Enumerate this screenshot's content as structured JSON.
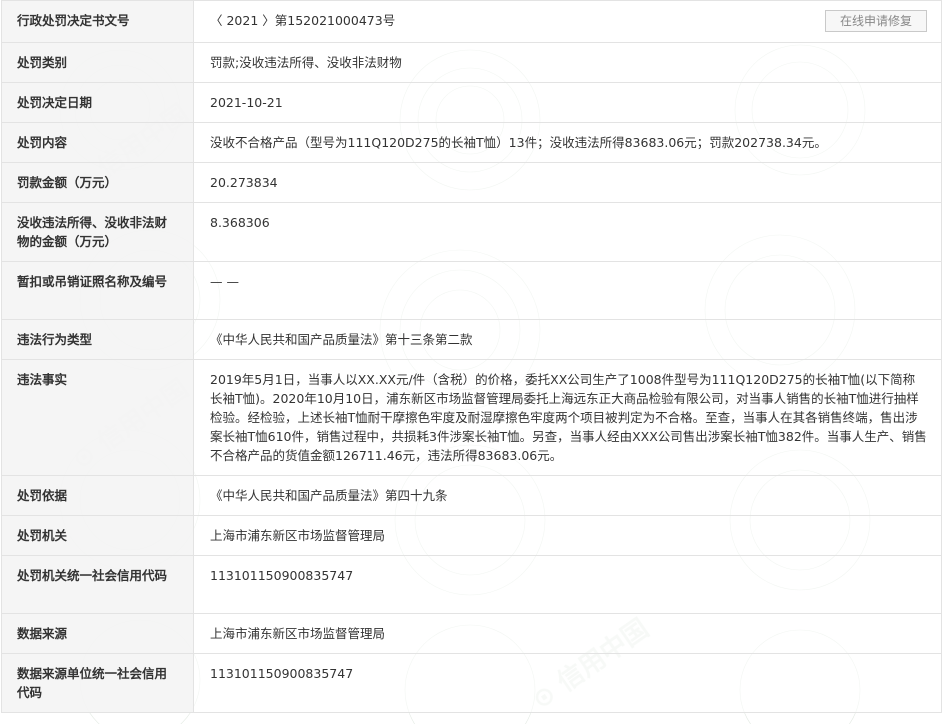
{
  "repair_button": "在线申请修复",
  "rows": [
    {
      "label": "行政处罚决定书文号",
      "value": "〈 2021 〉第152021000473号"
    },
    {
      "label": "处罚类别",
      "value": "罚款;没收违法所得、没收非法财物"
    },
    {
      "label": "处罚决定日期",
      "value": "2021-10-21"
    },
    {
      "label": "处罚内容",
      "value": "没收不合格产品（型号为111Q120D275的长袖T恤）13件；没收违法所得83683.06元；罚款202738.34元。"
    },
    {
      "label": "罚款金额（万元）",
      "value": "20.273834"
    },
    {
      "label": "没收违法所得、没收非法财物的金额（万元）",
      "value": "8.368306"
    },
    {
      "label": "暂扣或吊销证照名称及编号",
      "value": "— —"
    },
    {
      "label": "违法行为类型",
      "value": "《中华人民共和国产品质量法》第十三条第二款"
    },
    {
      "label": "违法事实",
      "value": "2019年5月1日，当事人以XX.XX元/件（含税）的价格，委托XX公司生产了1008件型号为111Q120D275的长袖T恤(以下简称长袖T恤)。2020年10月10日，浦东新区市场监督管理局委托上海远东正大商品检验有限公司，对当事人销售的长袖T恤进行抽样检验。经检验，上述长袖T恤耐干摩擦色牢度及耐湿摩擦色牢度两个项目被判定为不合格。至查，当事人在其各销售终端，售出涉案长袖T恤610件，销售过程中，共损耗3件涉案长袖T恤。另查，当事人经由XXX公司售出涉案长袖T恤382件。当事人生产、销售不合格产品的货值金额126711.46元，违法所得83683.06元。"
    },
    {
      "label": "处罚依据",
      "value": "《中华人民共和国产品质量法》第四十九条"
    },
    {
      "label": "处罚机关",
      "value": "上海市浦东新区市场监督管理局"
    },
    {
      "label": "处罚机关统一社会信用代码",
      "value": "11310115090083574​7"
    },
    {
      "label": "数据来源",
      "value": "上海市浦东新区市场监督管理局"
    },
    {
      "label": "数据来源单位统一社会信用代码",
      "value": "113101150900835747"
    }
  ]
}
